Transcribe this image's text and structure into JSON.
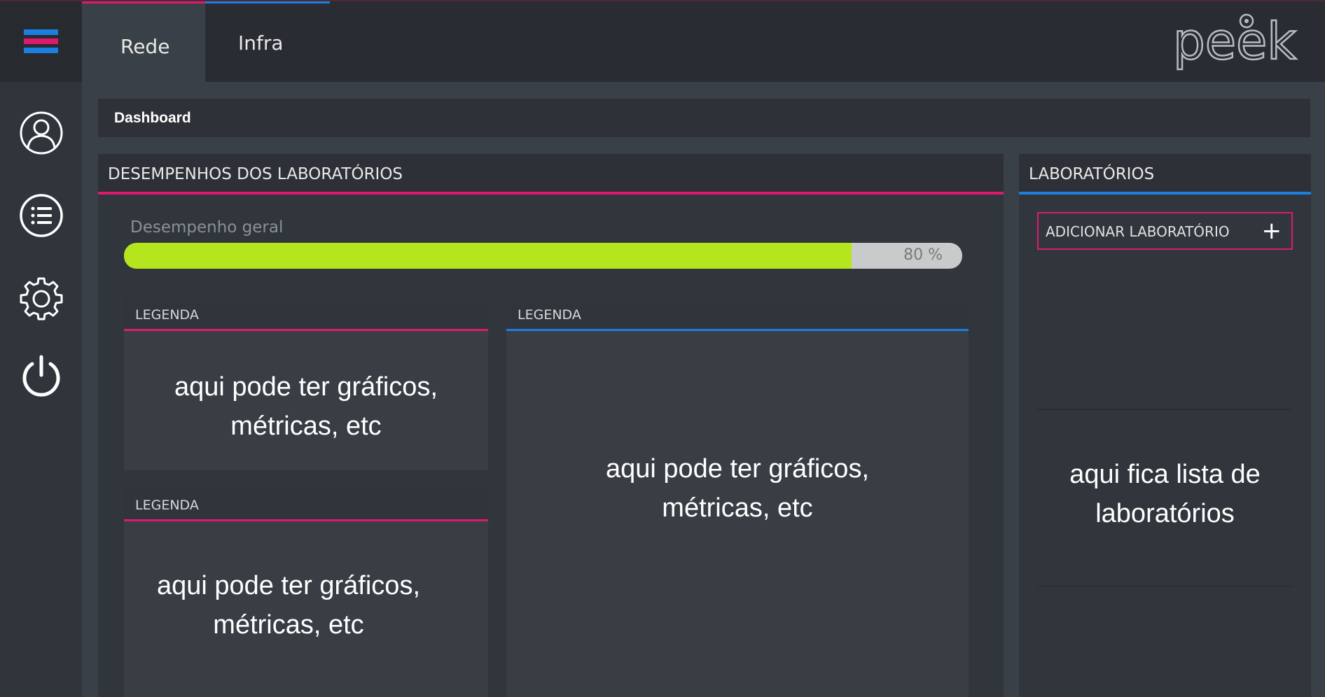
{
  "colors": {
    "accent_pink": "#e0196f",
    "accent_blue": "#1b7fe0",
    "progress_green": "#b5e61d"
  },
  "header": {
    "menu_icon": "hamburger-icon",
    "tabs": [
      {
        "label": "Rede",
        "active": true
      },
      {
        "label": "Infra",
        "active": false
      }
    ],
    "logo_text": "peek"
  },
  "sidebar": {
    "items": [
      {
        "icon": "user-icon"
      },
      {
        "icon": "list-icon"
      },
      {
        "icon": "gear-icon"
      },
      {
        "icon": "power-icon"
      }
    ]
  },
  "breadcrumb": {
    "label": "Dashboard"
  },
  "performance": {
    "title": "DESEMPENHOS DOS LABORATÓRIOS",
    "progress": {
      "label": "Desempenho geral",
      "value_text": "80 %",
      "value": 80
    },
    "cards": [
      {
        "header": "LEGENDA",
        "body_line1": "aqui pode ter gráficos,",
        "body_line2": "métricas, etc"
      },
      {
        "header": "LEGENDA",
        "body_line1": "aqui pode ter gráficos,",
        "body_line2": "métricas, etc"
      },
      {
        "header": "LEGENDA",
        "body_line1": "aqui pode ter gráficos,",
        "body_line2": "métricas, etc"
      }
    ]
  },
  "labs": {
    "title": "LABORATÓRIOS",
    "add_button": "ADICIONAR LABORATÓRIO",
    "add_icon": "+",
    "placeholder_line1": "aqui fica lista de",
    "placeholder_line2": "laboratórios"
  }
}
